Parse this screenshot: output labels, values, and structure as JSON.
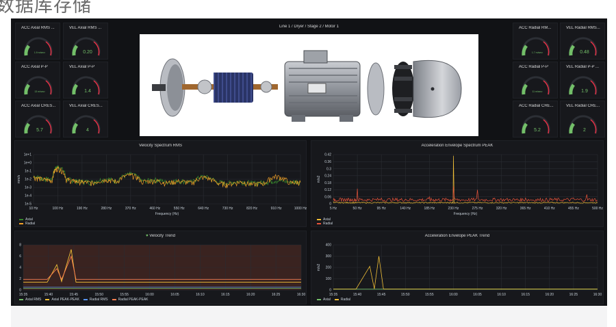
{
  "page_title": "数据库存储",
  "dashboard_title": "Line 1 / Dryer / Stage 2 / Motor 1",
  "gauges_left": [
    {
      "title": "ACC Axial RMS ...",
      "value": "1.9 m/sec²",
      "small": true
    },
    {
      "title": "VEL Axial RMS ...",
      "value": "0.20",
      "small": false
    },
    {
      "title": "ACC Axial P-P",
      "value": "13 m/sec²",
      "small": true
    },
    {
      "title": "VEL Axial P-P",
      "value": "1.4",
      "small": false
    },
    {
      "title": "ACC Axial CRES...",
      "value": "5.7",
      "small": false
    },
    {
      "title": "VEL Axial CRES...",
      "value": "4",
      "small": false
    }
  ],
  "gauges_right": [
    {
      "title": "ACC Radial RM...",
      "value": "1.7 m/sec²",
      "small": true
    },
    {
      "title": "VEL Radial RMS...",
      "value": "0.48",
      "small": false
    },
    {
      "title": "ACC Radial P-P",
      "value": "11 m/sec²",
      "small": true
    },
    {
      "title": "VEL Radial P-P ...",
      "value": "1.9",
      "small": false
    },
    {
      "title": "ACC Radial CRE...",
      "value": "5.2",
      "small": false
    },
    {
      "title": "VEL Radial CRE...",
      "value": "2",
      "small": false
    }
  ],
  "velocity_spectrum": {
    "title": "Velocity Spectrum RMS",
    "ylabel": "mm/s",
    "xlabel": "Frequency (Hz)",
    "yticks": [
      "1e+1",
      "1e+0",
      "1e-1",
      "1e-2",
      "1e-3",
      "1e-4",
      "1e-5"
    ],
    "xticks": [
      "10 Hz",
      "100 Hz",
      "190 Hz",
      "280 Hz",
      "370 Hz",
      "460 Hz",
      "550 Hz",
      "640 Hz",
      "730 Hz",
      "820 Hz",
      "910 Hz",
      "1000 Hz"
    ],
    "legend": [
      "Axial",
      "Radial"
    ],
    "colors": [
      "#37872d",
      "#f2a127"
    ]
  },
  "accel_spectrum": {
    "title": "Acceleration Envelope Spectrum PEAK",
    "ylabel": "m/s2",
    "xlabel": "Frequency (Hz)",
    "yticks": [
      "0.42",
      "0.36",
      "0.3",
      "0.24",
      "0.18",
      "0.12",
      "0.06",
      "0"
    ],
    "xticks": [
      "5 Hz",
      "50 Hz",
      "95 Hz",
      "140 Hz",
      "185 Hz",
      "230 Hz",
      "275 Hz",
      "320 Hz",
      "365 Hz",
      "410 Hz",
      "455 Hz",
      "500 Hz"
    ],
    "legend": [
      "Axial",
      "Radial"
    ],
    "colors": [
      "#f2c037",
      "#e8533a"
    ]
  },
  "velocity_trend": {
    "title": "Velocity Trend",
    "yticks": [
      "8",
      "6",
      "4",
      "2",
      "0"
    ],
    "xticks": [
      "15:35",
      "15:40",
      "15:45",
      "15:50",
      "15:55",
      "16:00",
      "16:05",
      "16:10",
      "16:15",
      "16:20",
      "16:25",
      "16:30"
    ],
    "legend": [
      "Axial RMS",
      "Axial PEAK-PEAK",
      "Radial RMS",
      "Radial PEAK-PEAK"
    ],
    "colors": [
      "#73bf69",
      "#f2c037",
      "#5794f2",
      "#ff7f50"
    ]
  },
  "accel_trend": {
    "title": "Acceleration Envelope PEAK Trend",
    "ylabel": "m/s2",
    "yticks": [
      "400",
      "300",
      "200",
      "100",
      "0"
    ],
    "xticks": [
      "15:35",
      "15:40",
      "15:45",
      "15:50",
      "15:55",
      "16:00",
      "16:05",
      "16:10",
      "16:15",
      "16:20",
      "16:25",
      "16:30"
    ],
    "legend": [
      "Axial",
      "Radial"
    ],
    "colors": [
      "#73bf69",
      "#f2c037"
    ]
  },
  "chart_data": [
    {
      "type": "line",
      "title": "Velocity Spectrum RMS",
      "xlabel": "Frequency (Hz)",
      "ylabel": "mm/s",
      "yscale": "log",
      "x_hz": [
        10,
        45,
        80,
        100,
        130,
        160,
        190,
        230,
        280,
        320,
        370,
        410,
        460,
        500,
        550,
        600,
        640,
        690,
        730,
        780,
        820,
        870,
        910,
        960,
        1000
      ],
      "series": [
        {
          "name": "Axial",
          "values": [
            0.02,
            0.01,
            0.008,
            0.3,
            0.01,
            0.006,
            0.005,
            0.004,
            0.01,
            0.005,
            0.04,
            0.005,
            0.008,
            0.004,
            0.006,
            0.004,
            0.02,
            0.004,
            0.003,
            0.005,
            0.003,
            0.004,
            0.006,
            0.004,
            0.005
          ]
        },
        {
          "name": "Radial",
          "values": [
            0.015,
            0.008,
            0.006,
            0.2,
            0.008,
            0.005,
            0.004,
            0.003,
            0.008,
            0.004,
            0.03,
            0.004,
            0.006,
            0.003,
            0.005,
            0.003,
            0.015,
            0.003,
            0.002,
            0.004,
            0.002,
            0.003,
            0.02,
            0.003,
            0.004
          ]
        }
      ]
    },
    {
      "type": "line",
      "title": "Acceleration Envelope Spectrum PEAK",
      "xlabel": "Frequency (Hz)",
      "ylabel": "m/s2",
      "x_hz": [
        5,
        20,
        35,
        50,
        70,
        95,
        120,
        140,
        165,
        185,
        200,
        220,
        230,
        250,
        275,
        300,
        320,
        345,
        365,
        390,
        410,
        430,
        455,
        480,
        500
      ],
      "series": [
        {
          "name": "Axial",
          "values": [
            0.02,
            0.01,
            0.01,
            0.01,
            0.01,
            0.01,
            0.01,
            0.01,
            0.01,
            0.01,
            0.01,
            0.01,
            0.41,
            0.01,
            0.01,
            0.01,
            0.01,
            0.01,
            0.01,
            0.01,
            0.01,
            0.01,
            0.01,
            0.01,
            0.01
          ]
        },
        {
          "name": "Radial",
          "values": [
            0.03,
            0.02,
            0.03,
            0.13,
            0.03,
            0.05,
            0.03,
            0.04,
            0.03,
            0.06,
            0.03,
            0.04,
            0.15,
            0.03,
            0.12,
            0.03,
            0.04,
            0.03,
            0.05,
            0.03,
            0.04,
            0.03,
            0.05,
            0.08,
            0.03
          ]
        }
      ]
    },
    {
      "type": "line",
      "title": "Velocity Trend",
      "x": [
        "15:35",
        "15:40",
        "15:42",
        "15:43",
        "15:45",
        "15:46",
        "15:50",
        "16:00",
        "16:10",
        "16:20",
        "16:30",
        "16:33"
      ],
      "series": [
        {
          "name": "Axial RMS",
          "values": [
            0.3,
            0.3,
            0.3,
            0.3,
            0.3,
            0.3,
            0.3,
            0.3,
            0.3,
            0.3,
            0.3,
            0.3
          ]
        },
        {
          "name": "Axial PEAK-PEAK",
          "values": [
            1.4,
            1.4,
            4.5,
            1.5,
            7.2,
            1.4,
            1.4,
            1.4,
            1.4,
            1.4,
            1.4,
            1.4
          ]
        },
        {
          "name": "Radial RMS",
          "values": [
            0.5,
            0.5,
            0.5,
            0.5,
            0.5,
            0.5,
            0.5,
            0.5,
            0.5,
            0.5,
            0.5,
            0.5
          ]
        },
        {
          "name": "Radial PEAK-PEAK",
          "values": [
            1.9,
            1.9,
            3.8,
            1.9,
            6.0,
            1.9,
            1.9,
            1.9,
            1.9,
            1.9,
            1.9,
            1.9
          ]
        }
      ],
      "ylim": [
        0,
        8
      ]
    },
    {
      "type": "line",
      "title": "Acceleration Envelope PEAK Trend",
      "ylabel": "m/s2",
      "x": [
        "15:35",
        "15:40",
        "15:43",
        "15:44",
        "15:45",
        "15:46",
        "15:50",
        "16:00",
        "16:10",
        "16:20",
        "16:30",
        "16:33"
      ],
      "series": [
        {
          "name": "Axial",
          "values": [
            8,
            8,
            8,
            8,
            8,
            8,
            8,
            8,
            8,
            8,
            8,
            8
          ]
        },
        {
          "name": "Radial",
          "values": [
            10,
            10,
            210,
            10,
            300,
            10,
            10,
            10,
            10,
            10,
            10,
            10
          ]
        }
      ],
      "ylim": [
        0,
        400
      ]
    }
  ]
}
